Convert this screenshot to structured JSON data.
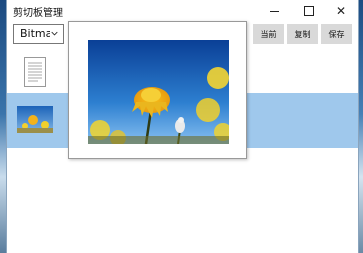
{
  "window": {
    "title": "剪切板管理",
    "controls": {
      "minimize_icon": "minimize-icon",
      "maximize_icon": "maximize-icon",
      "close_icon": "close-icon",
      "close_glyph": "✕"
    }
  },
  "toolbar": {
    "format_select": {
      "value": "Bitmap",
      "icon": "chevron-down-icon"
    },
    "buttons": {
      "current": "当前",
      "copy": "复制",
      "save": "保存"
    }
  },
  "list": {
    "items": [
      {
        "type": "text-document",
        "icon": "document-icon",
        "selected": false
      },
      {
        "type": "image",
        "icon": "image-thumbnail",
        "selected": true
      }
    ]
  },
  "preview": {
    "kind": "image",
    "subject": "yellow-flower-against-blue-sky"
  },
  "colors": {
    "selection": "#9fc8ec",
    "button_bg": "#d9d9d9",
    "desktop": "#3b78b0"
  }
}
